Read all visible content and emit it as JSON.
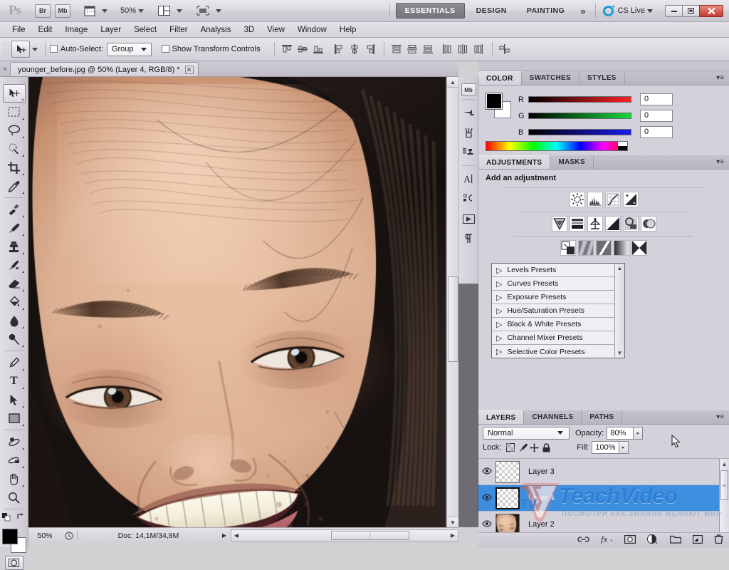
{
  "app": {
    "name": "Ps",
    "titlebar": {
      "bridge_label": "Br",
      "minibridge_label": "Mb",
      "zoom_level": "50%",
      "workspaces": [
        {
          "label": "ESSENTIALS",
          "active": true
        },
        {
          "label": "DESIGN",
          "active": false
        },
        {
          "label": "PAINTING",
          "active": false
        }
      ],
      "more_workspaces": "»",
      "cs_live": "CS Live",
      "window_buttons": {
        "minimize": "–",
        "maximize": "□",
        "close": "✕"
      }
    },
    "menubar": [
      "File",
      "Edit",
      "Image",
      "Layer",
      "Select",
      "Filter",
      "Analysis",
      "3D",
      "View",
      "Window",
      "Help"
    ],
    "options_bar": {
      "tool_icon": "move-tool-icon",
      "auto_select_label": "Auto-Select:",
      "auto_select_checked": false,
      "auto_select_value": "Group",
      "show_transform_label": "Show Transform Controls",
      "show_transform_checked": false,
      "align_icons": [
        "align-top-edges-icon",
        "align-vertical-centers-icon",
        "align-bottom-edges-icon",
        "align-left-edges-icon",
        "align-horizontal-centers-icon",
        "align-right-edges-icon"
      ],
      "distribute_icons": [
        "distribute-top-edges-icon",
        "distribute-vertical-centers-icon",
        "distribute-bottom-edges-icon",
        "distribute-left-edges-icon",
        "distribute-horizontal-centers-icon",
        "distribute-right-edges-icon"
      ],
      "auto_align_icon": "auto-align-layers-icon"
    }
  },
  "document": {
    "tab_title": "younger_before.jpg @ 50% (Layer 4, RGB/8) *",
    "close_glyph": "✕"
  },
  "toolbar": {
    "tools": [
      {
        "name": "move-tool",
        "glyph": "➤",
        "selected": true
      },
      {
        "name": "rectangular-marquee-tool",
        "glyph": "⬚",
        "selected": false
      },
      {
        "name": "lasso-tool",
        "glyph": "○",
        "selected": false
      },
      {
        "name": "quick-selection-tool",
        "glyph": "◌",
        "selected": false
      },
      {
        "name": "crop-tool",
        "glyph": "⛶",
        "selected": false
      },
      {
        "name": "eyedropper-tool",
        "glyph": "✒",
        "selected": false
      },
      {
        "name": "spot-healing-brush-tool",
        "glyph": "✐",
        "selected": false
      },
      {
        "name": "brush-tool",
        "glyph": "✎",
        "selected": false
      },
      {
        "name": "clone-stamp-tool",
        "glyph": "⚓",
        "selected": false
      },
      {
        "name": "history-brush-tool",
        "glyph": "✒",
        "selected": false
      },
      {
        "name": "eraser-tool",
        "glyph": "▰",
        "selected": false
      },
      {
        "name": "gradient-tool",
        "glyph": "◨",
        "selected": false
      },
      {
        "name": "blur-tool",
        "glyph": "●",
        "selected": false
      },
      {
        "name": "dodge-tool",
        "glyph": "⚲",
        "selected": false
      },
      {
        "name": "pen-tool",
        "glyph": "✑",
        "selected": false
      },
      {
        "name": "horizontal-type-tool",
        "glyph": "T",
        "selected": false
      },
      {
        "name": "path-selection-tool",
        "glyph": "➤",
        "selected": false
      },
      {
        "name": "rectangle-tool",
        "glyph": "■",
        "selected": false
      },
      {
        "name": "3d-object-rotate-tool",
        "glyph": "◔",
        "selected": false
      },
      {
        "name": "3d-camera-rotate-tool",
        "glyph": "◑",
        "selected": false
      },
      {
        "name": "hand-tool",
        "glyph": "✋",
        "selected": false
      },
      {
        "name": "zoom-tool",
        "glyph": "⚲",
        "selected": false
      }
    ],
    "foreground_color": "#000000",
    "background_color": "#ffffff",
    "quick_mask_label": "quick-mask-mode"
  },
  "dock": {
    "icons": [
      {
        "name": "mini-bridge-icon",
        "label": "Mb"
      },
      {
        "name": "history-icon",
        "label": "➶"
      },
      {
        "name": "brush-presets-icon",
        "label": "⑂"
      },
      {
        "name": "clone-source-icon",
        "label": "⎙"
      },
      {
        "name": "character-icon",
        "label": "A"
      },
      {
        "name": "paragraph-styles-icon",
        "label": "¶"
      },
      {
        "name": "animation-icon",
        "label": "▶"
      },
      {
        "name": "paragraph-icon",
        "label": "¶"
      }
    ]
  },
  "color_panel": {
    "tabs": [
      {
        "label": "COLOR",
        "active": true
      },
      {
        "label": "SWATCHES",
        "active": false
      },
      {
        "label": "STYLES",
        "active": false
      }
    ],
    "channels": [
      {
        "label": "R",
        "value": "0",
        "color": "#ff0000"
      },
      {
        "label": "G",
        "value": "0",
        "color": "#00cc22"
      },
      {
        "label": "B",
        "value": "0",
        "color": "#1111ff"
      }
    ],
    "foreground": "#000000",
    "background": "#ffffff",
    "menu_glyph": "▾≡"
  },
  "adjustments_panel": {
    "tabs": [
      {
        "label": "ADJUSTMENTS",
        "active": true
      },
      {
        "label": "MASKS",
        "active": false
      }
    ],
    "heading": "Add an adjustment",
    "row1": [
      "brightness-contrast-icon",
      "levels-icon",
      "curves-icon",
      "exposure-icon"
    ],
    "row2": [
      "vibrance-icon",
      "hue-saturation-icon",
      "color-balance-icon",
      "black-white-icon",
      "photo-filter-icon",
      "channel-mixer-icon"
    ],
    "row3": [
      "invert-icon",
      "posterize-icon",
      "threshold-icon",
      "gradient-map-icon",
      "selective-color-icon"
    ],
    "presets": [
      "Levels Presets",
      "Curves Presets",
      "Exposure Presets",
      "Hue/Saturation Presets",
      "Black & White Presets",
      "Channel Mixer Presets",
      "Selective Color Presets"
    ],
    "footer_icons": [
      "return-to-adjustment-list-icon",
      "clip-to-layer-icon"
    ],
    "menu_glyph": "▾≡"
  },
  "layers_panel": {
    "tabs": [
      {
        "label": "LAYERS",
        "active": true
      },
      {
        "label": "CHANNELS",
        "active": false
      },
      {
        "label": "PATHS",
        "active": false
      }
    ],
    "blend_mode": "Normal",
    "opacity_label": "Opacity:",
    "opacity_value": "80%",
    "lock_label": "Lock:",
    "lock_icons": [
      "lock-transparent-pixels-icon",
      "lock-image-pixels-icon",
      "lock-position-icon",
      "lock-all-icon"
    ],
    "fill_label": "Fill:",
    "fill_value": "100%",
    "layers": [
      {
        "name": "Layer 3",
        "visible": true,
        "selected": false,
        "thumb": "transparent"
      },
      {
        "name": "Layer 4",
        "visible": true,
        "selected": true,
        "thumb": "transparent"
      },
      {
        "name": "Layer 2",
        "visible": true,
        "selected": false,
        "thumb": "photo"
      }
    ],
    "footer_icons": [
      "link-layers-icon",
      "add-layer-style-icon",
      "add-layer-mask-icon",
      "new-fill-adjustment-layer-icon",
      "new-group-icon",
      "new-layer-icon",
      "delete-layer-icon"
    ],
    "menu_glyph": "▾≡"
  },
  "status_bar": {
    "zoom": "50%",
    "doc_info": "Doc: 14,1M/34,8M",
    "arrow_glyph": "▶"
  },
  "watermark": {
    "brand_tv": "TV",
    "brand_teach": "Teach",
    "brand_video": "Video",
    "tagline": "ПОСМОТРИ КАК ЗНАНИЯ МЕНЯЮТ МИР"
  },
  "colors": {
    "accent_blue": "#3d8ede",
    "chrome": "#d5d1da",
    "canvas_bg": "#6e6b73",
    "close_red": "#c4372c",
    "cslive_blue": "#1b9dd9"
  }
}
